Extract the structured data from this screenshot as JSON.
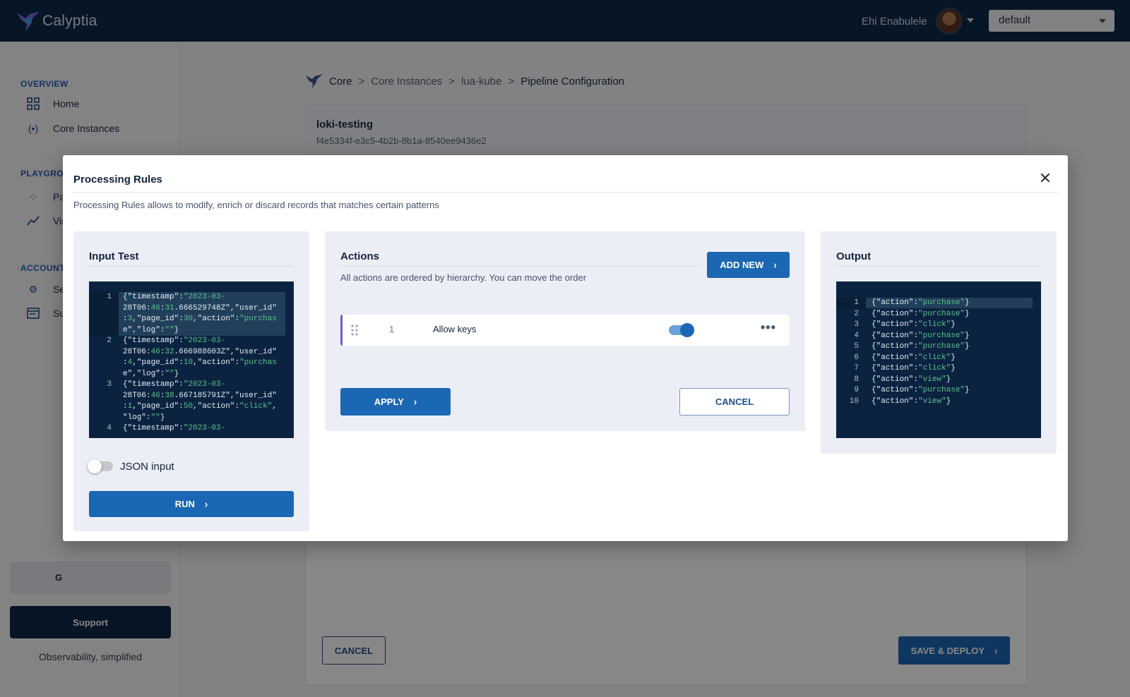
{
  "brand": {
    "name": "Calyptia"
  },
  "user": {
    "name": "Ehi Enabulele"
  },
  "tenant": {
    "selected": "default"
  },
  "sidebar": {
    "sections": [
      {
        "label": "OVERVIEW"
      },
      {
        "label": "PLAYGRO"
      },
      {
        "label": "ACCOUNT"
      }
    ],
    "items": [
      {
        "label": "Home",
        "icon": "grid-icon"
      },
      {
        "label": "Core Instances",
        "icon": "broadcast-icon"
      },
      {
        "label": "Pa",
        "icon": "dots-grid-icon"
      },
      {
        "label": "Vis",
        "icon": "trend-icon"
      },
      {
        "label": "Se",
        "icon": "gear-icon"
      },
      {
        "label": "Su",
        "icon": "card-icon"
      }
    ],
    "ghost_button": "G",
    "support_label": "Support",
    "tagline": "Observability, simplified"
  },
  "breadcrumb": {
    "items": [
      "Core",
      "Core Instances",
      "lua-kube",
      "Pipeline Configuration"
    ],
    "separator": ">"
  },
  "pipeline": {
    "title": "loki-testing",
    "id": "f4e5334f-e3c5-4b2b-8b1a-8540ee9436e2",
    "cancel_label": "CANCEL",
    "deploy_label": "SAVE & DEPLOY"
  },
  "modal": {
    "title": "Processing Rules",
    "description": "Processing Rules allows to modify, enrich or discard records that matches certain patterns",
    "input": {
      "title": "Input Test",
      "lines": [
        {
          "num": "1",
          "rows": [
            "{\"timestamp\":\"2023-03-",
            "28T06:46:31.666529748Z\",\"user_id\"",
            ":3,\"page_id\":30,\"action\":\"purchas",
            "e\",\"log\":\"\"}"
          ]
        },
        {
          "num": "2",
          "rows": [
            "{\"timestamp\":\"2023-03-",
            "28T06:46:32.666988603Z\",\"user_id\"",
            ":4,\"page_id\":10,\"action\":\"purchas",
            "e\",\"log\":\"\"}"
          ]
        },
        {
          "num": "3",
          "rows": [
            "{\"timestamp\":\"2023-03-",
            "28T06:46:38.667185791Z\",\"user_id\"",
            ":1,\"page_id\":50,\"action\":\"click\",",
            "\"log\":\"\"}"
          ]
        },
        {
          "num": "4",
          "rows": [
            "{\"timestamp\":\"2023-03-"
          ]
        }
      ],
      "json_toggle_label": "JSON input",
      "json_toggle_on": false,
      "run_label": "RUN"
    },
    "actions": {
      "title": "Actions",
      "description": "All actions are ordered by hierarchy. You can move the order",
      "add_new_label": "ADD NEW",
      "rows": [
        {
          "order": "1",
          "label": "Allow keys",
          "enabled": true
        }
      ],
      "apply_label": "APPLY",
      "cancel_label": "CANCEL"
    },
    "output": {
      "title": "Output",
      "lines": [
        {
          "num": "1",
          "action": "purchase"
        },
        {
          "num": "2",
          "action": "purchase"
        },
        {
          "num": "3",
          "action": "click"
        },
        {
          "num": "4",
          "action": "purchase"
        },
        {
          "num": "5",
          "action": "purchase"
        },
        {
          "num": "6",
          "action": "click"
        },
        {
          "num": "7",
          "action": "click"
        },
        {
          "num": "8",
          "action": "view"
        },
        {
          "num": "9",
          "action": "purchase"
        },
        {
          "num": "10",
          "action": "view"
        }
      ]
    }
  },
  "colors": {
    "topbar": "#0f2a4a",
    "primary": "#1c67b3",
    "code_bg": "#0b2340",
    "string_token": "#57c28a",
    "row_accent": "#6b5fd2"
  }
}
